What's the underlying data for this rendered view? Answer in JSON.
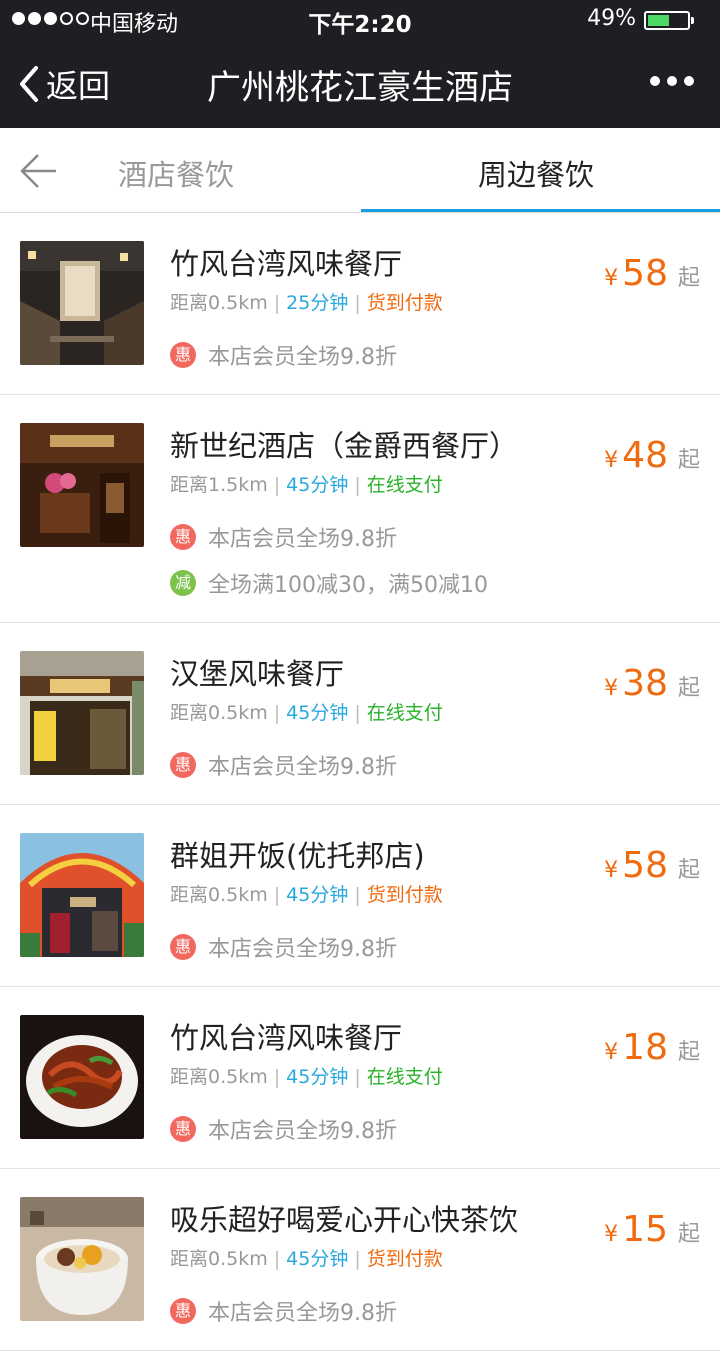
{
  "status_bar": {
    "carrier": "中国移动",
    "time": "下午2:20",
    "battery_percent": "49%",
    "battery_level": 0.49,
    "signal_bars": 3,
    "signal_total": 5
  },
  "nav": {
    "back_label": "返回",
    "title": "广州桃花江豪生酒店",
    "more_icon": "more-dots-icon"
  },
  "tabs": {
    "back_icon": "arrow-left-icon",
    "items": [
      {
        "label": "酒店餐饮",
        "active": false
      },
      {
        "label": "周边餐饮",
        "active": true
      }
    ],
    "active_color": "#1b9de8"
  },
  "colors": {
    "price": "#f06a0f",
    "time": "#29a8e0",
    "pay_cod": "#f06a0f",
    "pay_online": "#2bb22b",
    "badge_hui": "#f1695e",
    "badge_jian": "#7cc24b"
  },
  "restaurants": [
    {
      "name": "竹风台湾风味餐厅",
      "distance": "距离0.5km",
      "delivery_time": "25分钟",
      "payment": "货到付款",
      "payment_type": "cod",
      "currency": "¥",
      "price": "58",
      "price_suffix": "起",
      "promos": [
        {
          "badge": "惠",
          "type": "hui",
          "text": "本店会员全场9.8折"
        }
      ]
    },
    {
      "name": "新世纪酒店（金爵西餐厅）",
      "distance": "距离1.5km",
      "delivery_time": "45分钟",
      "payment": "在线支付",
      "payment_type": "online",
      "currency": "¥",
      "price": "48",
      "price_suffix": "起",
      "promos": [
        {
          "badge": "惠",
          "type": "hui",
          "text": "本店会员全场9.8折"
        },
        {
          "badge": "减",
          "type": "jian",
          "text": "全场满100减30，满50减10"
        }
      ]
    },
    {
      "name": "汉堡风味餐厅",
      "distance": "距离0.5km",
      "delivery_time": "45分钟",
      "payment": "在线支付",
      "payment_type": "online",
      "currency": "¥",
      "price": "38",
      "price_suffix": "起",
      "promos": [
        {
          "badge": "惠",
          "type": "hui",
          "text": "本店会员全场9.8折"
        }
      ]
    },
    {
      "name": "群姐开饭(优托邦店)",
      "distance": "距离0.5km",
      "delivery_time": "45分钟",
      "payment": "货到付款",
      "payment_type": "cod",
      "currency": "¥",
      "price": "58",
      "price_suffix": "起",
      "promos": [
        {
          "badge": "惠",
          "type": "hui",
          "text": "本店会员全场9.8折"
        }
      ]
    },
    {
      "name": "竹风台湾风味餐厅",
      "distance": "距离0.5km",
      "delivery_time": "45分钟",
      "payment": "在线支付",
      "payment_type": "online",
      "currency": "¥",
      "price": "18",
      "price_suffix": "起",
      "promos": [
        {
          "badge": "惠",
          "type": "hui",
          "text": "本店会员全场9.8折"
        }
      ]
    },
    {
      "name": "吸乐超好喝爱心开心快茶饮",
      "distance": "距离0.5km",
      "delivery_time": "45分钟",
      "payment": "货到付款",
      "payment_type": "cod",
      "currency": "¥",
      "price": "15",
      "price_suffix": "起",
      "promos": [
        {
          "badge": "惠",
          "type": "hui",
          "text": "本店会员全场9.8折"
        }
      ]
    }
  ]
}
